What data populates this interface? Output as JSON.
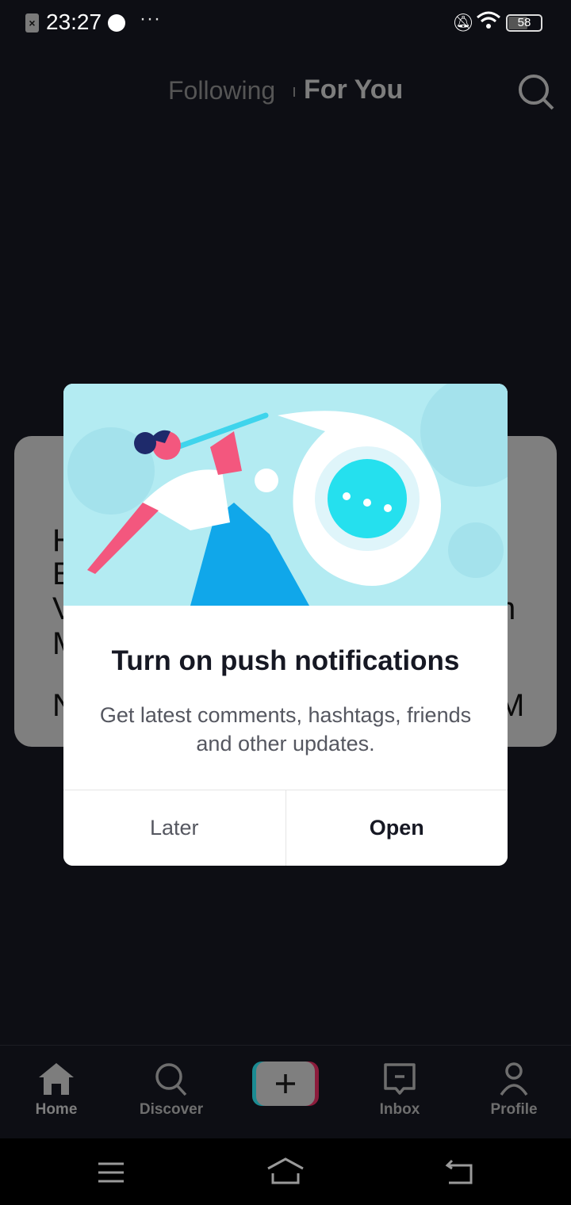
{
  "status_bar": {
    "time": "23:27",
    "battery": "58",
    "sim_icon": "sim-error-icon"
  },
  "top_nav": {
    "following": "Following",
    "for_you": "For You",
    "active": "For You"
  },
  "background_card": {
    "left_letters": [
      "H",
      "E",
      "V",
      "M",
      "N"
    ],
    "right_letters": [
      "n",
      "M"
    ]
  },
  "dialog": {
    "title": "Turn on push notifications",
    "description": "Get latest comments, hashtags, friends and other updates.",
    "later": "Later",
    "open": "Open",
    "accent": "#25d9ec"
  },
  "tab_bar": {
    "items": [
      {
        "label": "Home",
        "icon": "home-icon",
        "active": true
      },
      {
        "label": "Discover",
        "icon": "search-icon"
      },
      {
        "label": "",
        "icon": "plus-icon"
      },
      {
        "label": "Inbox",
        "icon": "inbox-icon"
      },
      {
        "label": "Profile",
        "icon": "profile-icon"
      }
    ]
  },
  "system_nav": {
    "menu": "menu-icon",
    "home": "home-outline-icon",
    "back": "back-icon"
  }
}
